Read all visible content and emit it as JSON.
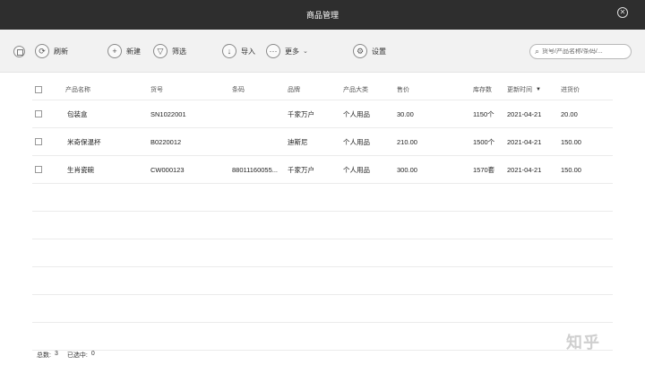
{
  "window": {
    "title": "商品管理"
  },
  "toolbar": {
    "refresh": "刷新",
    "new": "新建",
    "filter": "筛选",
    "import": "导入",
    "more": "更多",
    "settings": "设置"
  },
  "search": {
    "placeholder": "货号/产品名称/条码/..."
  },
  "table": {
    "headers": [
      "产品名称",
      "货号",
      "条码",
      "品牌",
      "产品大类",
      "售价",
      "库存数",
      "更新时间",
      "进货价"
    ],
    "rows": [
      [
        "包装盒",
        "SN1022001",
        "",
        "千家万户",
        "个人用品",
        "30.00",
        "1150个",
        "2021-04-21",
        "20.00"
      ],
      [
        "米奇保温杯",
        "B0220012",
        "",
        "迪斯尼",
        "个人用品",
        "210.00",
        "1500个",
        "2021-04-21",
        "150.00"
      ],
      [
        "生肖瓷碗",
        "CW000123",
        "88011160055...",
        "千家万户",
        "个人用品",
        "300.00",
        "1570套",
        "2021-04-21",
        "150.00"
      ]
    ]
  },
  "footer": {
    "total_label": "总数:",
    "total_value": "3",
    "selected_label": "已选中:",
    "selected_value": "0"
  },
  "watermark": "知乎"
}
